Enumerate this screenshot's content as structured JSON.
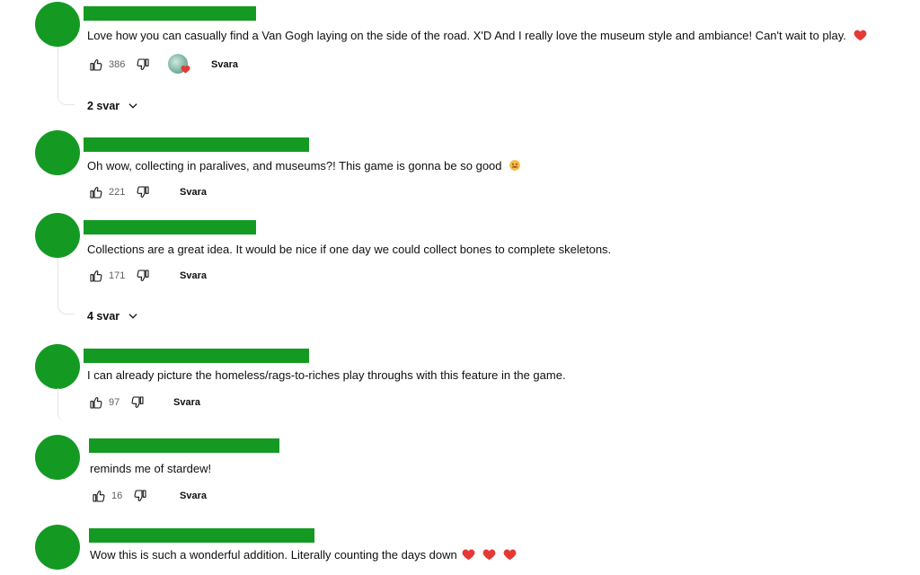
{
  "comments": [
    {
      "text": "Love how you can casually find a Van Gogh laying on the side of the road. X'D And I really love the museum style and ambiance! Can't wait to play.",
      "likes": "386",
      "reply_label": "Svara",
      "replies_label": "2 svar",
      "hearted": true,
      "emoji": "heart"
    },
    {
      "text": "Oh wow, collecting in paralives, and museums?! This game is gonna be so good",
      "likes": "221",
      "reply_label": "Svara",
      "emoji": "face"
    },
    {
      "text": "Collections are a great idea. It would be nice if one day we could collect bones to complete skeletons.",
      "likes": "171",
      "reply_label": "Svara",
      "replies_label": "4 svar"
    },
    {
      "text": "I can already picture the homeless/rags-to-riches play throughs with this feature in the game.",
      "likes": "97",
      "reply_label": "Svara"
    },
    {
      "text": "reminds me of stardew!",
      "likes": "16",
      "reply_label": "Svara"
    },
    {
      "text": "Wow this is such a wonderful addition. Literally counting the days down",
      "emoji": "three-hearts"
    }
  ],
  "colors": {
    "name_redacted": "#149a23",
    "avatar": "#149a23",
    "heart": "#e53935"
  },
  "icons": {
    "like": "thumbs-up-icon",
    "dislike": "thumbs-down-icon",
    "chevron": "chevron-down-icon",
    "heart": "heart-icon"
  }
}
